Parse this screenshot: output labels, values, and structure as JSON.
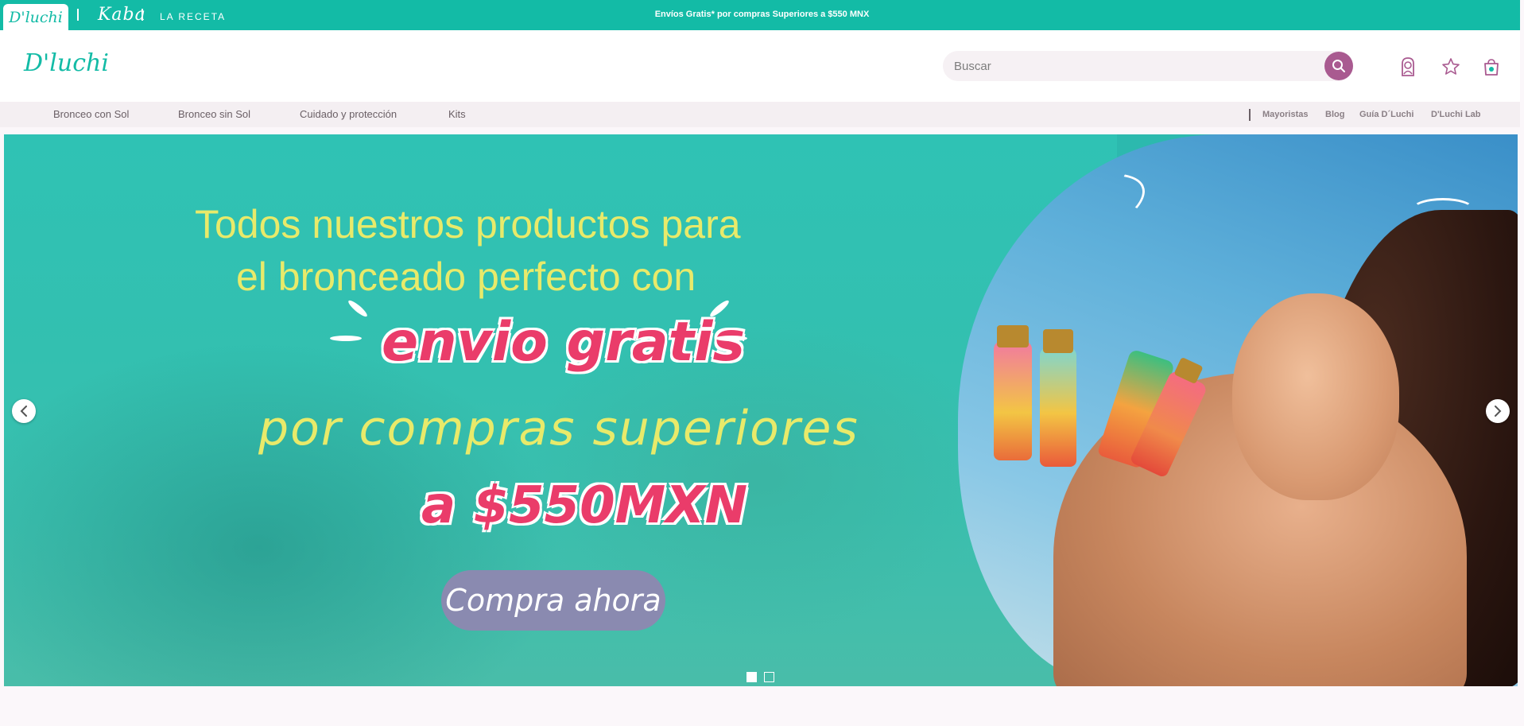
{
  "topbar": {
    "brands": [
      "D'luchi",
      "Kaba",
      "LA RECETA"
    ],
    "promo": "Envíos Gratis* por compras Superiores a $550 MNX",
    "color": "#13bba6"
  },
  "header": {
    "logo": "D'luchi",
    "search": {
      "placeholder": "Buscar"
    },
    "icons": [
      "search-icon",
      "account-icon",
      "star-icon",
      "bag-icon"
    ]
  },
  "nav": {
    "left": [
      "Bronceo con Sol",
      "Bronceo sin Sol",
      "Cuidado y protección",
      "Kits"
    ],
    "right": [
      "Mayoristas",
      "Blog",
      "Guía D´Luchi",
      "D'Luchi Lab"
    ]
  },
  "hero": {
    "line1": "Todos nuestros productos para",
    "line2": "el bronceado perfecto con",
    "highlight": "envio gratis",
    "line3": "por compras superiores",
    "price": "a $550MXN",
    "cta": "Compra ahora",
    "slides": 2,
    "active_slide": 1
  }
}
